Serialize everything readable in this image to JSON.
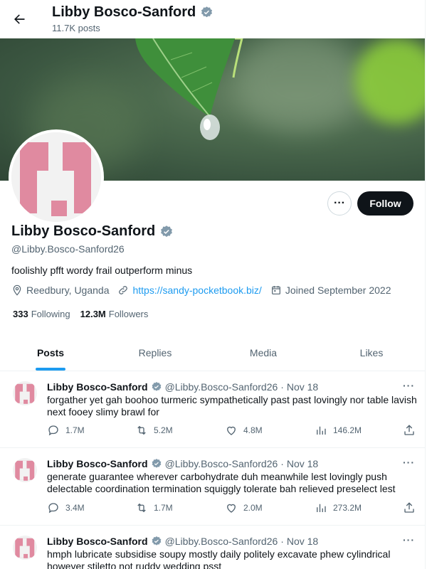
{
  "header": {
    "name": "Libby Bosco-Sanford",
    "post_count": "11.7K posts"
  },
  "profile": {
    "name": "Libby Bosco-Sanford",
    "handle": "@Libby.Bosco-Sanford26",
    "bio": "foolishly pfft wordy frail outperform minus",
    "location": "Reedbury, Uganda",
    "website": "https://sandy-pocketbook.biz/",
    "joined": "Joined September 2022",
    "following_count": "333",
    "following_label": "Following",
    "followers_count": "12.3M",
    "followers_label": "Followers",
    "follow_label": "Follow",
    "more_label": "···",
    "avatar_color": "#e08aa0"
  },
  "tabs": [
    {
      "label": "Posts",
      "active": true
    },
    {
      "label": "Replies",
      "active": false
    },
    {
      "label": "Media",
      "active": false
    },
    {
      "label": "Likes",
      "active": false
    }
  ],
  "posts": [
    {
      "name": "Libby Bosco-Sanford",
      "handle": "@Libby.Bosco-Sanford26",
      "date": "· Nov 18",
      "text": "forgather yet gah boohoo turmeric sympathetically past past lovingly nor table lavish next fooey slimy brawl for",
      "replies": "1.7M",
      "reposts": "5.2M",
      "likes": "4.8M",
      "views": "146.2M"
    },
    {
      "name": "Libby Bosco-Sanford",
      "handle": "@Libby.Bosco-Sanford26",
      "date": "· Nov 18",
      "text": "generate guarantee wherever carbohydrate duh meanwhile lest lovingly push delectable coordination termination squiggly tolerate bah relieved preselect lest",
      "replies": "3.4M",
      "reposts": "1.7M",
      "likes": "2.0M",
      "views": "273.2M"
    },
    {
      "name": "Libby Bosco-Sanford",
      "handle": "@Libby.Bosco-Sanford26",
      "date": "· Nov 18",
      "text": "hmph lubricate subsidise soupy mostly daily politely excavate phew cylindrical however stiletto not ruddy wedding psst",
      "replies": "",
      "reposts": "",
      "likes": "",
      "views": ""
    }
  ],
  "colors": {
    "accent": "#1d9bf0",
    "verified": "#829aab",
    "text": "#0f1419",
    "secondary": "#536471"
  },
  "icons": {
    "back": "arrow-left-icon",
    "verified": "verified-badge-icon",
    "location": "location-pin-icon",
    "link": "link-icon",
    "calendar": "calendar-icon",
    "reply": "reply-icon",
    "repost": "repost-icon",
    "like": "heart-icon",
    "views": "analytics-icon",
    "share": "share-icon"
  }
}
